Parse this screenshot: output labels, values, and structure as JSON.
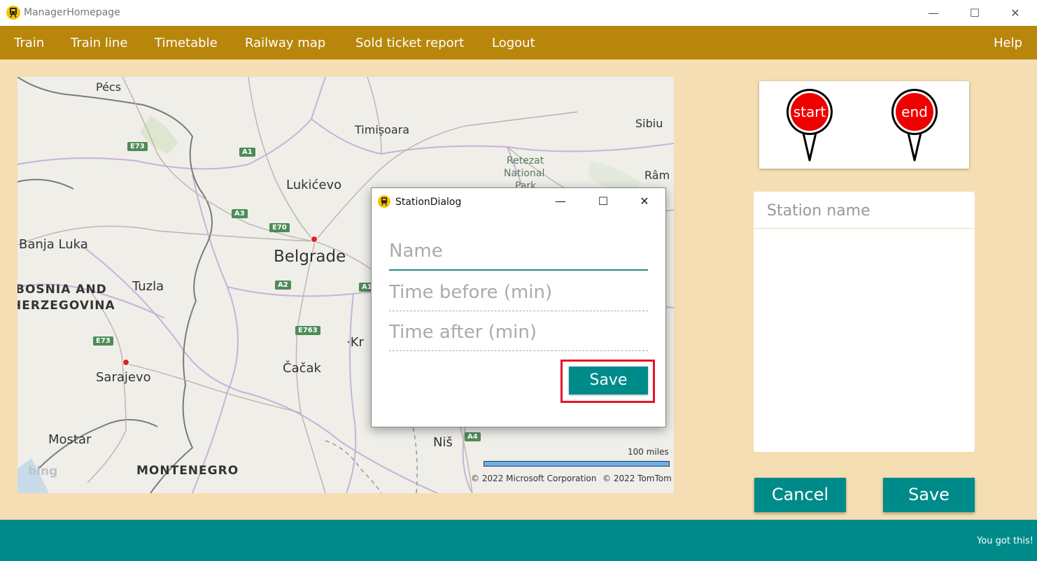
{
  "window": {
    "title": "ManagerHomepage"
  },
  "menu": {
    "items": [
      "Train",
      "Train line",
      "Timetable",
      "Railway map",
      "Sold ticket report",
      "Logout"
    ],
    "help": "Help"
  },
  "map": {
    "labels": {
      "pecs": "Pécs",
      "timisoara": "Timișoara",
      "sibiu": "Sibiu",
      "retezat1": "Retezat",
      "retezat2": "National",
      "retezat3": "Park",
      "ramnicu": "Râm",
      "lukicevo": "Lukićevo",
      "belgrade": "Belgrade",
      "banja_luka": "Banja Luka",
      "tuzla": "Tuzla",
      "bosnia1": "BOSNIA AND",
      "bosnia2": "HERZEGOVINA",
      "sarajevo": "Sarajevo",
      "cacak": "Čačak",
      "kr": "·Kr",
      "mostar": "Mostar",
      "montenegro": "MONTENEGRO",
      "nis": "Niš"
    },
    "shields": {
      "e73a": "E73",
      "a1a": "A1",
      "a3": "A3",
      "e70": "E70",
      "a2": "A2",
      "a1b": "A1",
      "e763": "E763",
      "e73b": "E73",
      "a4": "A4"
    },
    "scale_label": "100 miles",
    "copyright_ms": "© 2022 Microsoft Corporation",
    "copyright_tt": "© 2022 TomTom",
    "logo": "bing"
  },
  "pins": {
    "start": "start",
    "end": "end"
  },
  "station_list": {
    "header": "Station name"
  },
  "buttons": {
    "cancel": "Cancel",
    "save": "Save"
  },
  "dialog": {
    "title": "StationDialog",
    "name_placeholder": "Name",
    "time_before_placeholder": "Time before (min)",
    "time_after_placeholder": "Time after (min)",
    "save": "Save"
  },
  "status": {
    "text": "You got this!"
  },
  "colors": {
    "menubar": "#b8860b",
    "accent": "#008b8b",
    "background": "#f5deb3",
    "highlight": "#e5142a",
    "pin": "#ee0000"
  }
}
